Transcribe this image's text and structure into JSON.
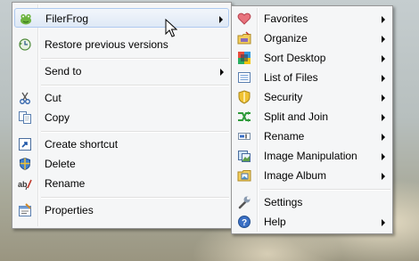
{
  "left_menu": {
    "items": [
      {
        "label": "FilerFrog",
        "icon": "frog-icon",
        "submenu": true
      },
      {
        "label": "Restore previous versions",
        "icon": "restore-icon"
      },
      {
        "label": "Send to",
        "submenu": true
      },
      {
        "label": "Cut",
        "icon": "scissors-icon"
      },
      {
        "label": "Copy",
        "icon": "copy-icon"
      },
      {
        "label": "Create shortcut",
        "icon": "shortcut-icon"
      },
      {
        "label": "Delete",
        "icon": "delete-icon"
      },
      {
        "label": "Rename",
        "icon": "rename-icon"
      },
      {
        "label": "Properties",
        "icon": "properties-icon"
      }
    ]
  },
  "right_menu": {
    "items": [
      {
        "label": "Favorites",
        "icon": "heart-icon",
        "submenu": true
      },
      {
        "label": "Organize",
        "icon": "folder-organize-icon",
        "submenu": true
      },
      {
        "label": "Sort Desktop",
        "icon": "sort-desktop-icon",
        "submenu": true
      },
      {
        "label": "List of Files",
        "icon": "list-icon",
        "submenu": true
      },
      {
        "label": "Security",
        "icon": "shield-icon",
        "submenu": true
      },
      {
        "label": "Split and Join",
        "icon": "split-join-icon",
        "submenu": true
      },
      {
        "label": "Rename",
        "icon": "rename-icon",
        "submenu": true
      },
      {
        "label": "Image Manipulation",
        "icon": "image-manipulation-icon",
        "submenu": true
      },
      {
        "label": "Image Album",
        "icon": "image-album-icon",
        "submenu": true
      },
      {
        "label": "Settings",
        "icon": "wrench-icon"
      },
      {
        "label": "Help",
        "icon": "help-icon",
        "submenu": true
      }
    ]
  },
  "colors": {
    "menu_bg": "#f5f6f7",
    "highlight_border": "#aecaf0"
  }
}
